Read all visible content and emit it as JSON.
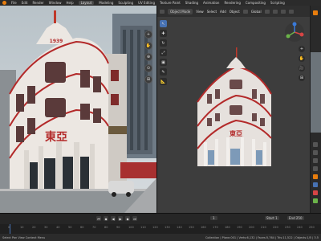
{
  "menu": {
    "items": [
      "File",
      "Edit",
      "Render",
      "Window",
      "Help"
    ],
    "workspaces": [
      "Layout",
      "Modeling",
      "Sculpting",
      "UV Editing",
      "Texture Paint",
      "Shading",
      "Animation",
      "Rendering",
      "Compositing",
      "Scripting"
    ],
    "active_workspace_index": 0
  },
  "photo_panel": {
    "sign_text": "東亞",
    "year_text": "1939",
    "tools": [
      "+",
      "✋",
      "⊕",
      "⊙",
      "⊞"
    ]
  },
  "viewport": {
    "editor_mode": "Object Mode",
    "menus": [
      "View",
      "Select",
      "Add",
      "Object"
    ],
    "global": "Global",
    "tools": [
      "↖",
      "✚",
      "↻",
      "⤢",
      "▣",
      "✎",
      "📐"
    ],
    "nav": [
      "+",
      "✋",
      "🎥",
      "⊞"
    ],
    "model_sign": "東亞"
  },
  "timeline": {
    "current_frame": "1",
    "start_label": "Start",
    "start": "1",
    "end_label": "End",
    "end": "250",
    "ticks": [
      "0",
      "10",
      "20",
      "30",
      "40",
      "50",
      "60",
      "70",
      "80",
      "90",
      "100",
      "110",
      "120",
      "130",
      "140",
      "150",
      "160",
      "170",
      "180",
      "190",
      "200",
      "210",
      "220",
      "230",
      "240",
      "250"
    ]
  },
  "status_bar": {
    "left": "Select      Pan View      Context Menu",
    "right": "Collection | Plane.001 | Verts:6,132 | Faces:5,764 | Tris:11,522 | Objects:1/5 | 3.5"
  },
  "colors": {
    "accent": "#4772b3",
    "logo": "#e87d0d",
    "sign_red": "#b32a2a"
  }
}
